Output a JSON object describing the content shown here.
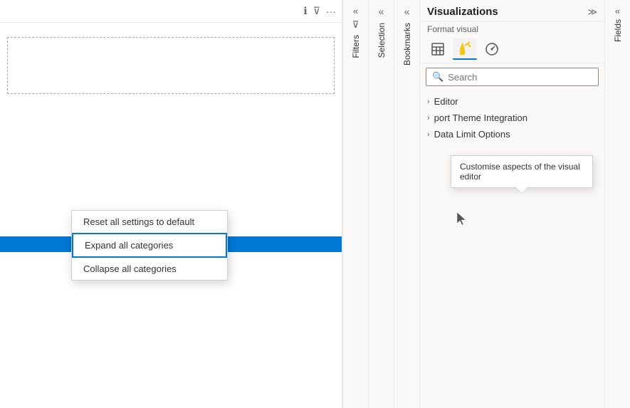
{
  "canvas": {
    "icons": {
      "info": "ℹ",
      "filter": "⊽",
      "more": "···"
    }
  },
  "panels": {
    "filters_label": "Filters",
    "selection_label": "Selection",
    "bookmarks_label": "Bookmarks",
    "fields_label": "Fields"
  },
  "visualizations": {
    "title": "Visualizations",
    "chevron_left": "≪",
    "chevron_right": "≫",
    "format_visual_label": "Format visual",
    "toolbar": {
      "table_icon": "⊞",
      "format_icon": "✏",
      "analytics_icon": "📊"
    },
    "search_placeholder": "Search",
    "tooltip_text": "Customise aspects of the visual editor",
    "sections": {
      "editor_label": "Editor",
      "report_theme_label": "port Theme Integration",
      "data_limit_label": "Data Limit Options"
    }
  },
  "context_menu": {
    "items": [
      {
        "id": "reset",
        "label": "Reset all settings to default"
      },
      {
        "id": "expand",
        "label": "Expand all categories"
      },
      {
        "id": "collapse",
        "label": "Collapse all categories"
      }
    ]
  }
}
